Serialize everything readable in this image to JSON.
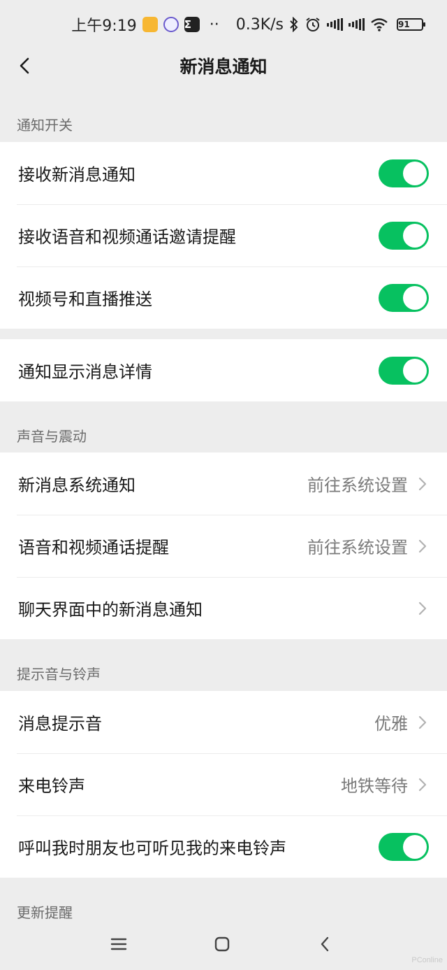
{
  "status_bar": {
    "time": "上午9:19",
    "dots": "··",
    "network_speed": "0.3K/s",
    "battery": "91",
    "icons": [
      "app-icon-orange",
      "app-icon-purple",
      "sigma-icon",
      "bluetooth-icon",
      "alarm-icon",
      "hd-signal-icon",
      "hd-signal-icon",
      "wifi-icon",
      "battery-icon"
    ]
  },
  "nav": {
    "title": "新消息通知",
    "back_icon": "chevron-left-icon"
  },
  "sections": {
    "notify_switch": {
      "label": "通知开关",
      "rows": [
        {
          "label": "接收新消息通知",
          "toggle": true
        },
        {
          "label": "接收语音和视频通话邀请提醒",
          "toggle": true
        },
        {
          "label": "视频号和直播推送",
          "toggle": true
        }
      ]
    },
    "detail": {
      "rows": [
        {
          "label": "通知显示消息详情",
          "toggle": true
        }
      ]
    },
    "sound_vibrate": {
      "label": "声音与震动",
      "rows": [
        {
          "label": "新消息系统通知",
          "value": "前往系统设置"
        },
        {
          "label": "语音和视频通话提醒",
          "value": "前往系统设置"
        },
        {
          "label": "聊天界面中的新消息通知",
          "value": ""
        }
      ]
    },
    "ringtone": {
      "label": "提示音与铃声",
      "rows": [
        {
          "label": "消息提示音",
          "value": "优雅"
        },
        {
          "label": "来电铃声",
          "value": "地铁等待"
        },
        {
          "label": "呼叫我时朋友也可听见我的来电铃声",
          "toggle": true
        }
      ]
    },
    "update": {
      "label": "更新提醒"
    }
  },
  "colors": {
    "toggle_on": "#07c160",
    "background": "#ededed"
  },
  "system_nav": {
    "icons": [
      "menu-icon",
      "home-icon",
      "back-icon"
    ]
  },
  "watermark": "PConline"
}
